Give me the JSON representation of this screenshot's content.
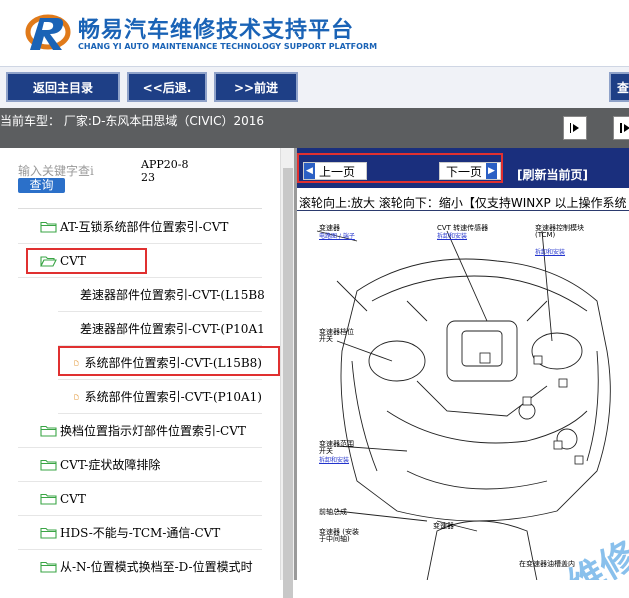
{
  "header": {
    "title": "畅易汽车维修技术支持平台",
    "subtitle": "CHANG YI AUTO MAINTENANCE TECHNOLOGY SUPPORT PLATFORM"
  },
  "nav": {
    "back_main": "返回主目录",
    "back": "<<后退.",
    "forward": ">>前进",
    "query": "查"
  },
  "vehicle": "当前车型： 厂家:D-东风本田思域（CIVIC）2016",
  "search": {
    "placeholder": "输入关键字查i",
    "button": "查询",
    "app_code": "APP20-823"
  },
  "tree": [
    {
      "label": "AT-互锁系统部件位置索引-CVT",
      "type": "folder"
    },
    {
      "label": "CVT",
      "type": "folder-open"
    },
    {
      "label": "差速器部件位置索引-CVT-(L15B8",
      "type": "doc"
    },
    {
      "label": "差速器部件位置索引-CVT-(P10A1",
      "type": "doc"
    },
    {
      "label": "系统部件位置索引-CVT-(L15B8)",
      "type": "doc"
    },
    {
      "label": "系统部件位置索引-CVT-(P10A1)",
      "type": "doc"
    },
    {
      "label": "换档位置指示灯部件位置索引-CVT",
      "type": "folder"
    },
    {
      "label": "CVT-症状故障排除",
      "type": "folder"
    },
    {
      "label": "CVT",
      "type": "folder"
    },
    {
      "label": "HDS-不能与-TCM-通信-CVT",
      "type": "folder"
    },
    {
      "label": "从-N-位置模式换档至-D-位置模式时",
      "type": "folder"
    }
  ],
  "viewer": {
    "prev_page": "上一页",
    "next_page": "下一页",
    "refresh": "[刷新当前页]",
    "hint": "滚轮向上:放大  滚轮向下：缩小【仅支持WINXP 以上操作系统"
  },
  "diagram_labels": {
    "l1": "变速器",
    "l2": "CVT 转速传感器",
    "l3": "变速器控制模块 (TCM)",
    "l4": "变速器档位开关",
    "l5": "在变速器油槽盖内",
    "l6": "变速器范围开关",
    "l7": "前轴总成",
    "l8": "变速器",
    "l9": "变速器 (安装于中间轴)",
    "watermark": "维修"
  },
  "colors": {
    "brand_blue": "#1a63b6",
    "nav_button": "#1e3f86",
    "page_bar": "#1a2f7d",
    "highlight_red": "#e03030",
    "info_bar": "#5c5e60"
  }
}
